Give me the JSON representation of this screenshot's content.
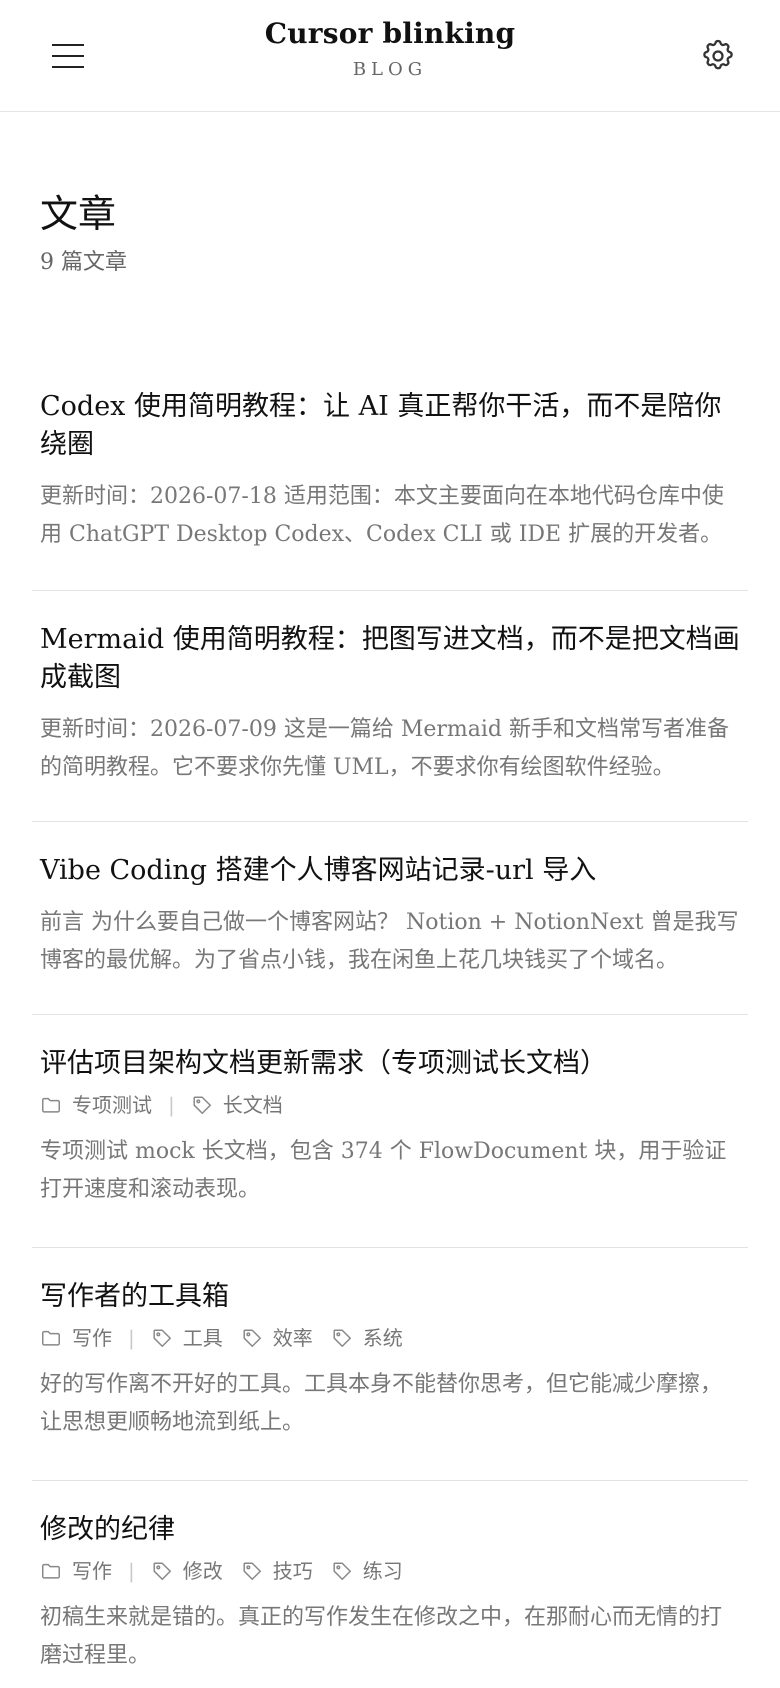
{
  "header": {
    "title": "Cursor blinking",
    "subtitle": "BLOG"
  },
  "page": {
    "title": "文章",
    "count": "9 篇文章"
  },
  "posts": [
    {
      "title": "Codex 使用简明教程：让 AI 真正帮你干活，而不是陪你绕圈",
      "category": "",
      "tags": [],
      "excerpt": "更新时间：2026-07-18 适用范围：本文主要面向在本地代码仓库中使用 ChatGPT Desktop Codex、Codex CLI 或 IDE 扩展的开发者。"
    },
    {
      "title": "Mermaid 使用简明教程：把图写进文档，而不是把文档画成截图",
      "category": "",
      "tags": [],
      "excerpt": "更新时间：2026-07-09 这是一篇给 Mermaid 新手和文档常写者准备的简明教程。它不要求你先懂 UML，不要求你有绘图软件经验。"
    },
    {
      "title": "Vibe Coding 搭建个人博客网站记录-url 导入",
      "category": "",
      "tags": [],
      "excerpt": "前言 为什么要自己做一个博客网站？ Notion + NotionNext 曾是我写博客的最优解。为了省点小钱，我在闲鱼上花几块钱买了个域名。"
    },
    {
      "title": "评估项目架构文档更新需求（专项测试长文档）",
      "category": "专项测试",
      "tags": [
        "长文档"
      ],
      "excerpt": "专项测试 mock 长文档，包含 374 个 FlowDocument 块，用于验证打开速度和滚动表现。"
    },
    {
      "title": "写作者的工具箱",
      "category": "写作",
      "tags": [
        "工具",
        "效率",
        "系统"
      ],
      "excerpt": "好的写作离不开好的工具。工具本身不能替你思考，但它能减少摩擦，让思想更顺畅地流到纸上。"
    },
    {
      "title": "修改的纪律",
      "category": "写作",
      "tags": [
        "修改",
        "技巧",
        "练习"
      ],
      "excerpt": "初稿生来就是错的。真正的写作发生在修改之中，在那耐心而无情的打磨过程里。"
    }
  ]
}
